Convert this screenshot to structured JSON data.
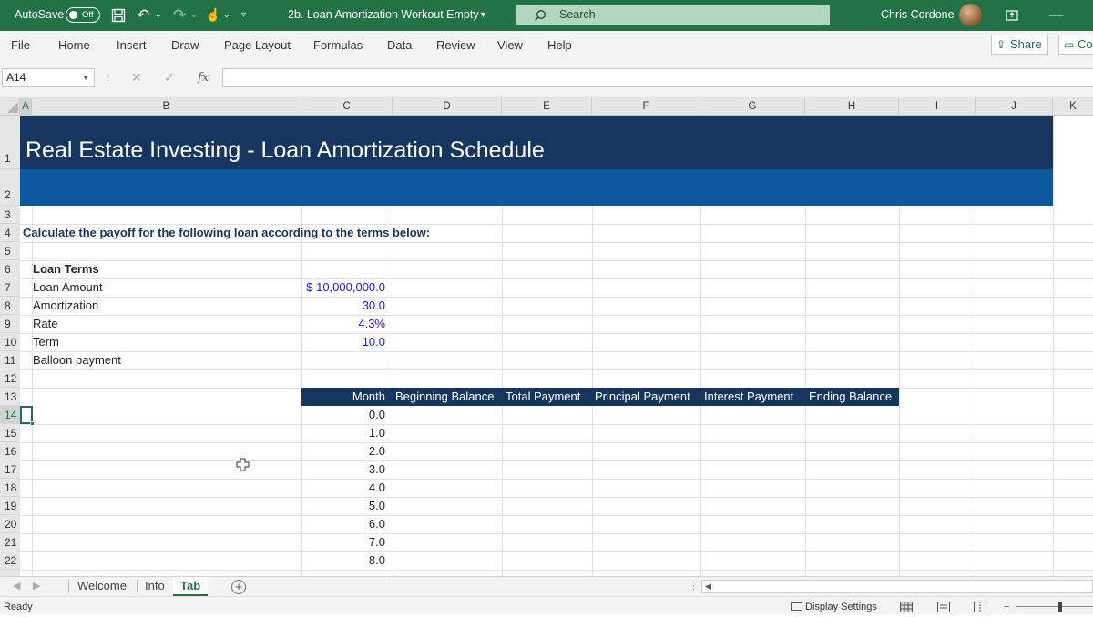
{
  "titlebar": {
    "autosave_label": "AutoSave",
    "autosave_state": "Off",
    "doc_title": "2b. Loan Amortization Workout Empty",
    "search_placeholder": "Search",
    "user_name": "Chris Cordone"
  },
  "ribbon": {
    "tabs": [
      "File",
      "Home",
      "Insert",
      "Draw",
      "Page Layout",
      "Formulas",
      "Data",
      "Review",
      "View",
      "Help"
    ],
    "share_label": "Share",
    "comments_label": "Co"
  },
  "formula_bar": {
    "name_box": "A14",
    "fx": "fx",
    "content": ""
  },
  "columns": [
    "A",
    "B",
    "C",
    "D",
    "E",
    "F",
    "G",
    "H",
    "I",
    "J",
    "K"
  ],
  "rows": [
    "1",
    "2",
    "3",
    "4",
    "5",
    "6",
    "7",
    "8",
    "9",
    "10",
    "11",
    "12",
    "13",
    "14",
    "15",
    "16",
    "17",
    "18",
    "19",
    "20",
    "21",
    "22"
  ],
  "sheet": {
    "title": "Real Estate Investing - Loan Amortization Schedule",
    "instruction": "Calculate the payoff for the following loan according to the terms below:",
    "loan_terms_header": "Loan Terms",
    "terms": [
      {
        "label": "Loan Amount",
        "value": "$ 10,000,000.0"
      },
      {
        "label": "Amortization",
        "value": "30.0"
      },
      {
        "label": "Rate",
        "value": "4.3%"
      },
      {
        "label": "Term",
        "value": "10.0"
      },
      {
        "label": "Balloon payment",
        "value": ""
      }
    ],
    "table_headers": [
      "Month",
      "Beginning Balance",
      "Total Payment",
      "Principal Payment",
      "Interest Payment",
      "Ending Balance"
    ],
    "months": [
      "0.0",
      "1.0",
      "2.0",
      "3.0",
      "4.0",
      "5.0",
      "6.0",
      "7.0",
      "8.0"
    ]
  },
  "sheet_tabs": {
    "tabs": [
      "Welcome",
      "Info",
      "Tab"
    ],
    "active": "Tab"
  },
  "status": {
    "ready": "Ready",
    "display_settings": "Display Settings"
  },
  "colors": {
    "excel_green": "#217346",
    "title_band_dark": "#16355f",
    "title_band_blue": "#0d599f",
    "input_blue": "#1a1adb"
  }
}
